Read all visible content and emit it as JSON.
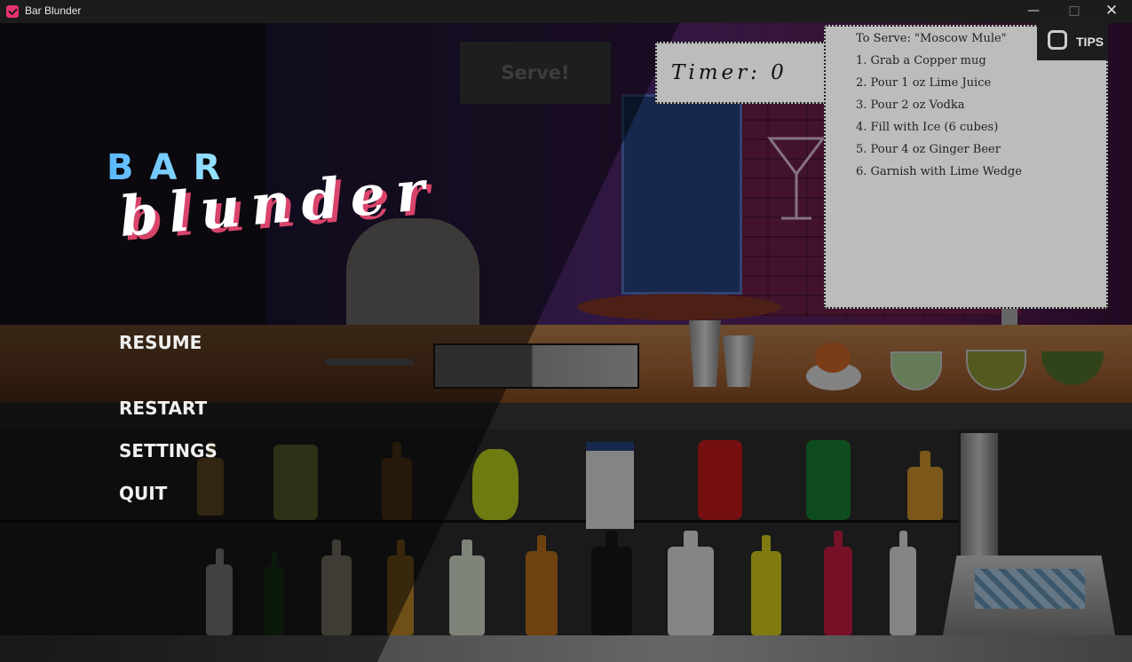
{
  "window": {
    "title": "Bar Blunder",
    "controls": [
      "minimize-icon",
      "maximize-icon",
      "close-icon"
    ]
  },
  "game": {
    "serve_label": "Serve!",
    "timer_label": "Timer: 0",
    "tips_label": "TIPS"
  },
  "recipe": {
    "heading": "To Serve: \"Moscow Mule\"",
    "steps": [
      "1. Grab a Copper mug",
      "2. Pour 1 oz Lime Juice",
      "3. Pour 2 oz Vodka",
      "4. Fill with Ice (6 cubes)",
      "5. Pour 4 oz Ginger Beer",
      "6. Garnish with Lime Wedge"
    ]
  },
  "logo": {
    "line1": "BAR",
    "line2": "blunder"
  },
  "pause_menu": {
    "items": [
      "RESUME",
      "RESTART",
      "SETTINGS",
      "QUIT"
    ]
  },
  "colors": {
    "logo_blue": "#5ab8ff",
    "logo_pink": "#d9446b",
    "panel_gray": "#bcbcbc",
    "counter_wood": "#c98a52"
  }
}
